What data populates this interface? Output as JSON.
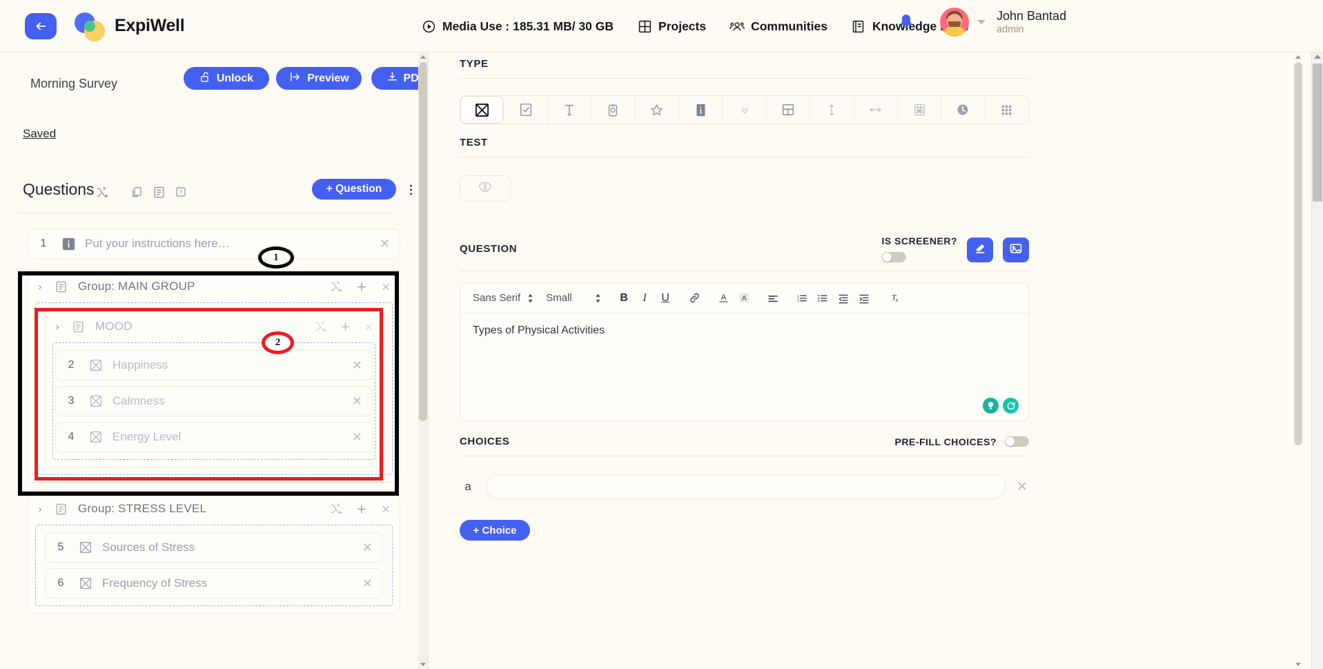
{
  "header": {
    "back_icon": "arrow-left-circle-icon",
    "brand": "ExpiWell",
    "nav": [
      {
        "icon": "play-circle-icon",
        "label": "Media Use : 185.31 MB/ 30 GB"
      },
      {
        "icon": "grid-projects-icon",
        "label": "Projects"
      },
      {
        "icon": "people-icon",
        "label": "Communities"
      },
      {
        "icon": "book-icon",
        "label": "Knowledge Base"
      }
    ],
    "bell_icon": "bell-icon",
    "user": {
      "name": "John Bantad",
      "role": "admin",
      "avatar": "user-avatar"
    }
  },
  "left": {
    "survey_title": "Morning Survey",
    "buttons": {
      "unlock": "Unlock",
      "preview": "Preview",
      "pdf": "PDF"
    },
    "saved": "Saved",
    "questions_heading": "Questions",
    "header_icons": [
      "shuffle-icon",
      "copy-icon",
      "list-icon",
      "help-icon"
    ],
    "add_question": "+ Question",
    "more_icon": "kebab-menu-icon",
    "tree": [
      {
        "kind": "question",
        "num": "1",
        "icon": "info-icon",
        "label": "Put your instructions here…"
      },
      {
        "kind": "group",
        "label": "Group: MAIN GROUP",
        "children": [
          {
            "kind": "group",
            "label": "MOOD",
            "children": [
              {
                "kind": "question",
                "num": "2",
                "icon": "multiple-choice-icon",
                "label": "Happiness"
              },
              {
                "kind": "question",
                "num": "3",
                "icon": "multiple-choice-icon",
                "label": "Calmness"
              },
              {
                "kind": "question",
                "num": "4",
                "icon": "multiple-choice-icon",
                "label": "Energy Level"
              }
            ]
          }
        ]
      },
      {
        "kind": "group",
        "label": "Group: STRESS LEVEL",
        "children": [
          {
            "kind": "question",
            "num": "5",
            "icon": "multiple-choice-icon",
            "label": "Sources of Stress"
          },
          {
            "kind": "question",
            "num": "6",
            "icon": "multiple-choice-icon",
            "label": "Frequency of Stress"
          }
        ]
      }
    ],
    "annotations": [
      {
        "id": "1",
        "color": "#000000"
      },
      {
        "id": "2",
        "color": "#ee1c1c"
      }
    ]
  },
  "right": {
    "type": {
      "label": "TYPE",
      "options": [
        "multiple-choice-icon",
        "checkbox-icon",
        "text-icon",
        "camera-icon",
        "star-rating-icon",
        "info-icon",
        "chevron-double-down-icon",
        "layout-icon",
        "vertical-slider-icon",
        "horizontal-slider-icon",
        "matrix-icon",
        "clock-icon",
        "grid-icon"
      ],
      "selected_index": 0
    },
    "test": {
      "label": "TEST",
      "button_icon": "brain-icon"
    },
    "question": {
      "label": "QUESTION",
      "is_screener_label": "IS SCREENER?",
      "is_screener_on": false,
      "eraser_icon": "eraser-icon",
      "image_icon": "image-icon",
      "toolbar": {
        "font_family": "Sans Serif",
        "font_size": "Small",
        "buttons": [
          "bold-icon",
          "italic-icon",
          "underline-icon",
          "link-icon",
          "font-color-icon",
          "highlight-color-icon",
          "align-icon",
          "ordered-list-icon",
          "bullet-list-icon",
          "outdent-icon",
          "indent-icon",
          "clear-format-icon"
        ]
      },
      "body_text": "Types of Physical Activities",
      "assist_icons": [
        "lightbulb-icon",
        "refresh-icon"
      ]
    },
    "choices": {
      "label": "CHOICES",
      "prefill_label": "PRE-FILL CHOICES?",
      "prefill_on": false,
      "rows": [
        {
          "key": "a",
          "value": ""
        }
      ],
      "add_choice": "+ Choice"
    }
  },
  "colors": {
    "accent": "#4460f1",
    "page_bg": "#fdfbf3",
    "annotation_red": "#ee1c1c",
    "annotation_black": "#000000",
    "teal": "#16b3a0"
  }
}
